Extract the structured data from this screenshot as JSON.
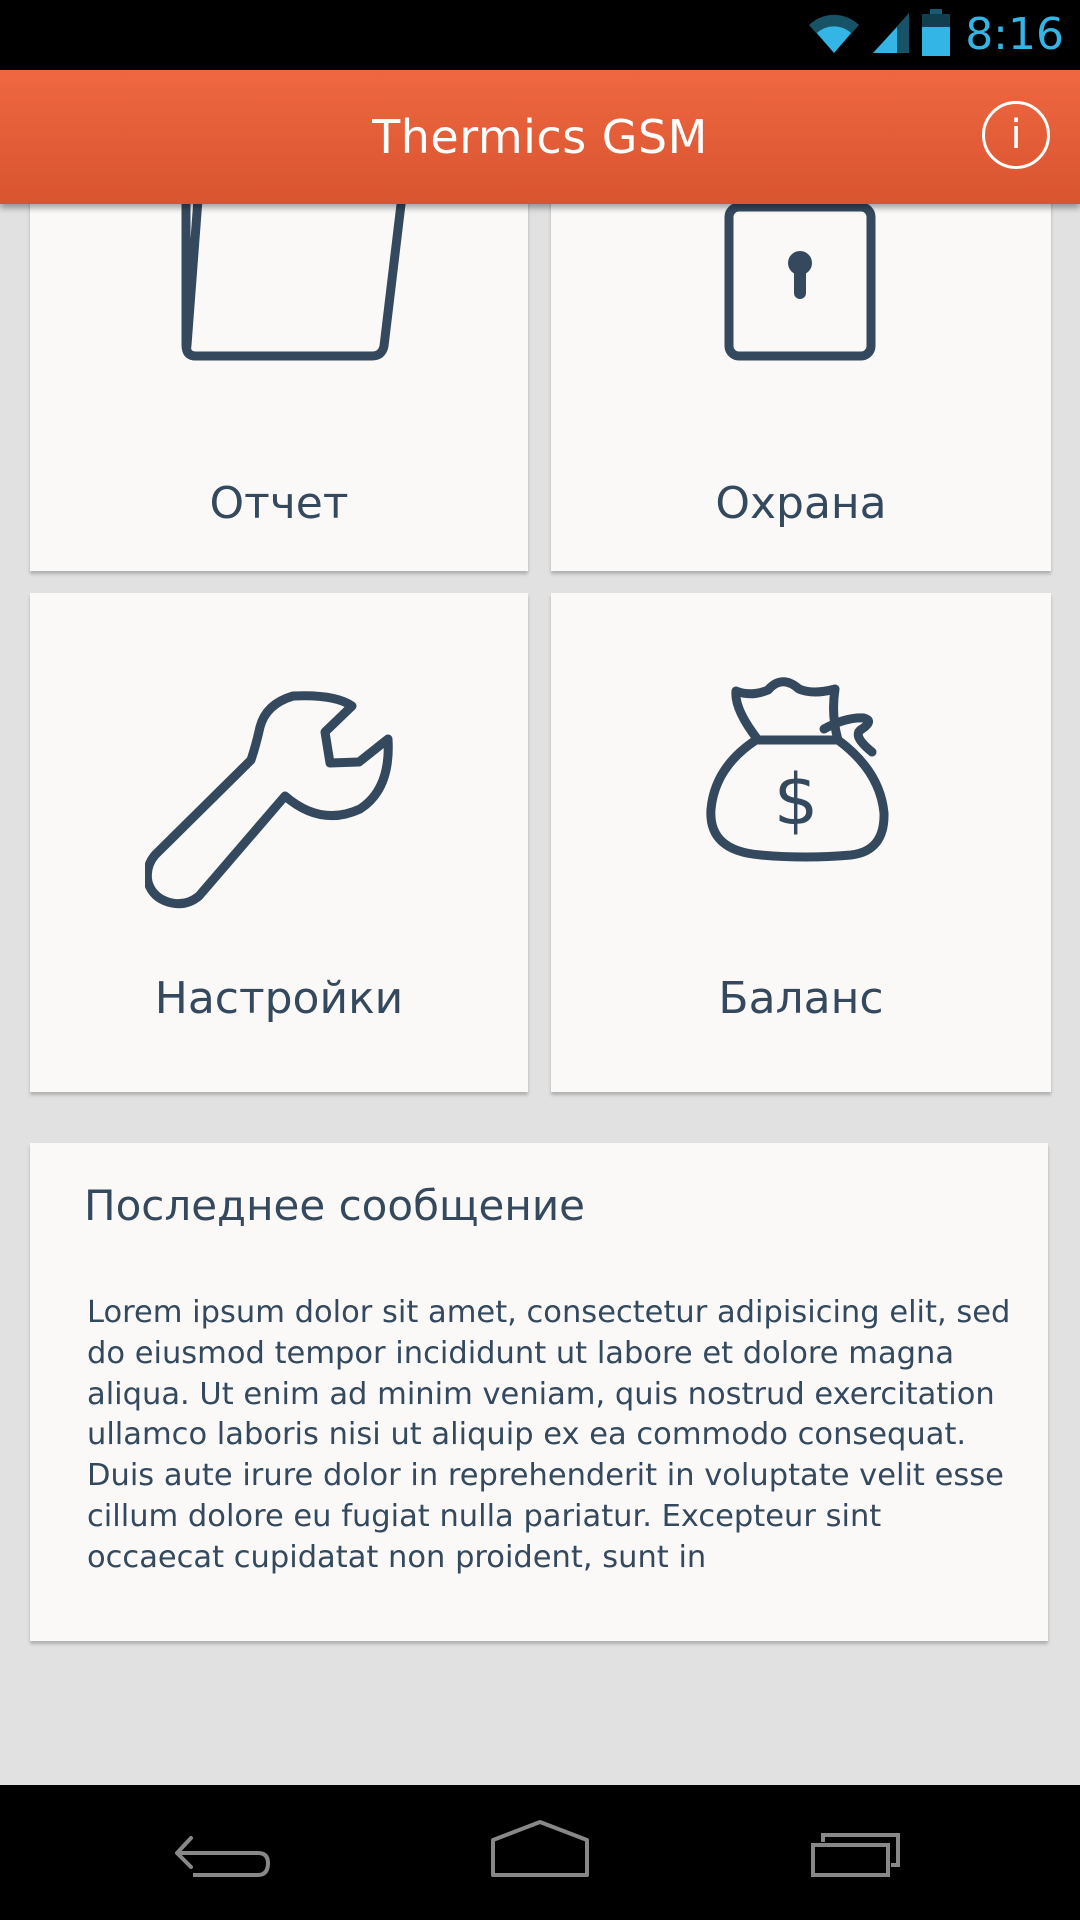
{
  "status_bar": {
    "time": "8:16",
    "icons": [
      "wifi-icon",
      "signal-icon",
      "battery-icon"
    ],
    "time_color": "#33b5e5"
  },
  "app_bar": {
    "title": "Thermics GSM",
    "info_icon": "info-icon",
    "info_glyph": "i",
    "background": "#e95f38"
  },
  "tiles": [
    {
      "label": "Отчет",
      "icon": "folder-icon"
    },
    {
      "label": "Охрана",
      "icon": "lock-icon"
    },
    {
      "label": "Настройки",
      "icon": "wrench-icon"
    },
    {
      "label": "Баланс",
      "icon": "money-bag-icon"
    }
  ],
  "message": {
    "title": "Последнее сообщение",
    "body": "Lorem ipsum dolor sit amet, consectetur adipisicing elit, sed do eiusmod tempor incididunt ut labore et dolore magna aliqua. Ut enim ad minim veniam, quis nostrud exercitation ullamco laboris nisi ut aliquip ex ea commodo consequat. Duis aute irure dolor in reprehenderit in voluptate velit esse cillum dolore eu fugiat nulla pariatur. Excepteur sint occaecat cupidatat non proident, sunt in"
  },
  "nav_bar": {
    "buttons": [
      "back-icon",
      "home-icon",
      "recent-apps-icon"
    ]
  },
  "colors": {
    "icon_stroke": "#34495e",
    "tile_background": "#faf9f8",
    "page_background": "#e1e1e1"
  }
}
